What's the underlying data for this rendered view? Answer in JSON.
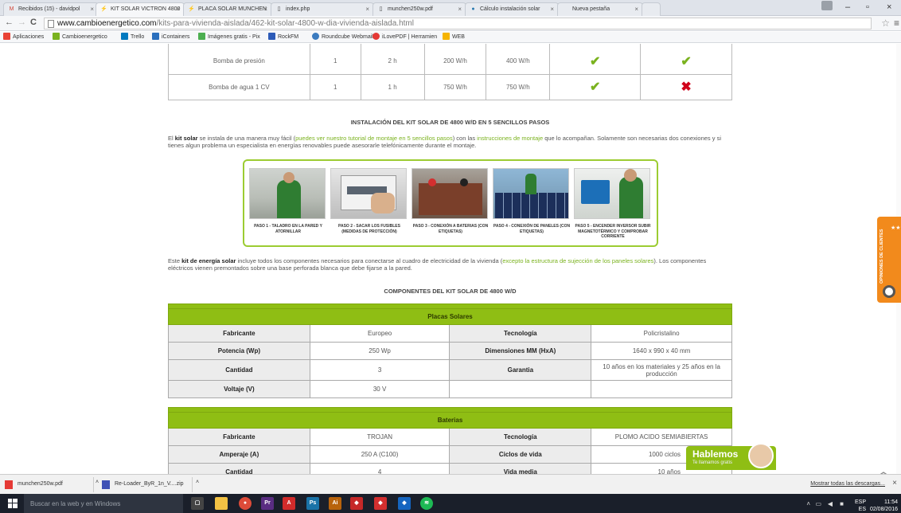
{
  "browser": {
    "tabs": [
      {
        "label": "Recibidos (15) - davidpol",
        "icon": "gmail-icon",
        "active": false
      },
      {
        "label": "KIT SOLAR VICTRON 4800",
        "icon": "site-icon",
        "active": true
      },
      {
        "label": "PLACA SOLAR MUNCHEN",
        "icon": "site-icon",
        "active": false
      },
      {
        "label": "index.php",
        "icon": "page-icon",
        "active": false
      },
      {
        "label": "munchen250w.pdf",
        "icon": "page-icon",
        "active": false
      },
      {
        "label": "Cálculo instalación solar",
        "icon": "globe-icon",
        "active": false
      },
      {
        "label": "Nueva pestaña",
        "icon": "blank-icon",
        "active": false
      }
    ],
    "url_domain": "www.cambioenergetico.com",
    "url_path": "/kits-para-vivienda-aislada/462-kit-solar-4800-w-dia-vivienda-aislada.html",
    "bookmarks": [
      {
        "label": "Aplicaciones",
        "color": "#e94235"
      },
      {
        "label": "Cambioenergetico",
        "color": "#7ab21e"
      },
      {
        "label": "Trello",
        "color": "#0079bf"
      },
      {
        "label": "iContainers",
        "color": "#2a6fbd"
      },
      {
        "label": "Imágenes gratis - Pix",
        "color": "#4caf50"
      },
      {
        "label": "RockFM",
        "color": "#2d5bb8"
      },
      {
        "label": "Roundcube Webmail",
        "color": "#3b7bbf"
      },
      {
        "label": "iLovePDF | Herramien",
        "color": "#e53935"
      },
      {
        "label": "WEB",
        "color": "#f5b400"
      }
    ]
  },
  "top_table": {
    "rows": [
      {
        "name": "Bomba de presión",
        "qty": "1",
        "hours": "2 h",
        "power": "200 W/h",
        "total": "400 W/h",
        "a": "check",
        "b": "check"
      },
      {
        "name": "Bomba de agua 1 CV",
        "qty": "1",
        "hours": "1 h",
        "power": "750 W/h",
        "total": "750 W/h",
        "a": "check",
        "b": "cross"
      }
    ]
  },
  "install": {
    "heading": "INSTALACIÓN DEL KIT SOLAR DE 4800 W/D EN 5 SENCILLOS PASOS",
    "p1_a": "El ",
    "p1_b": "kit solar",
    "p1_c": " se instala de una manera muy fácil (",
    "p1_link1": "puedes ver nuestro tutorial de montaje en 5 sencillos pasos",
    "p1_d": ") con las ",
    "p1_link2": "instrucciones de montaje",
    "p1_e": " que lo acompañan. Solamente son necesarias dos conexiones y si tienes algun problema un especialista en energías renovables puede asesorarle telefónicamente durante el montaje.",
    "steps": [
      "PASO 1 - TALADRO EN LA PARED Y ATORNILLAR",
      "PASO 2 - SACAR LOS FUSIBLES (MEDIDAS DE PROTECCIÓN)",
      "PASO 3 - CONEXIÓN A BATERIAS (CON ETIQUETAS)",
      "PASO 4 - CONEXIÓN DE PANELES (CON ETIQUETAS)",
      "PASO 5 - ENCENDER INVERSOR SUBIR MAGNETOTÉRMICO Y COMPROBAR CORRIENTE"
    ],
    "p2_a": "Este ",
    "p2_b": "kit de energía solar",
    "p2_c": " incluye todos los componentes necesarios para conectarse al cuadro de electricidad de la vivienda (",
    "p2_link": "excepto la estructura de sujección de los paneles solares",
    "p2_d": "). Los componentes eléctricos vienen premontados sobre una base perforada blanca que debe fijarse a la pared."
  },
  "components": {
    "heading": "COMPONENTES DEL KIT SOLAR DE 4800 W/D",
    "placas": {
      "title": "Placas Solares",
      "rows": [
        [
          "Fabricante",
          "Europeo",
          "Tecnología",
          "Policristalino"
        ],
        [
          "Potencia (Wp)",
          "250 Wp",
          "Dimensiones MM (HxA)",
          "1640 x 990 x 40 mm"
        ],
        [
          "Cantidad",
          "3",
          "Garantia",
          "10 años en los materiales y 25 años en la producción"
        ],
        [
          "Voltaje (V)",
          "30 V",
          "",
          ""
        ]
      ]
    },
    "baterias": {
      "title": "Baterias",
      "rows": [
        [
          "Fabricante",
          "TROJAN",
          "Tecnología",
          "PLOMO ACIDO SEMIABIERTAS"
        ],
        [
          "Amperaje (A)",
          "250 A (C100)",
          "Ciclos de vida",
          "1000 ciclos"
        ],
        [
          "Cantidad",
          "4",
          "Vida media",
          "10 años"
        ]
      ]
    }
  },
  "widgets": {
    "opinion_text": "OPINIONES DE CLIENTES",
    "stars": "★★★★★",
    "hablemos_title": "Hablemos",
    "hablemos_sub": "Te llamamos gratis"
  },
  "downloads": {
    "items": [
      "munchen250w.pdf",
      "Re-Loader_ByR_1n_V....zip"
    ],
    "show_all": "Mostrar todas las descargas..."
  },
  "taskbar": {
    "search_placeholder": "Buscar en la web y en Windows",
    "lang": "ESP",
    "lang2": "ES",
    "time": "11:54",
    "date": "02/08/2016",
    "apps": [
      {
        "name": "task-view-icon",
        "color": "#444",
        "glyph": "▢"
      },
      {
        "name": "file-explorer-icon",
        "color": "#f3c244",
        "glyph": ""
      },
      {
        "name": "chrome-icon",
        "color": "#dd4b39",
        "glyph": "●"
      },
      {
        "name": "premiere-icon",
        "color": "#5a2d82",
        "glyph": "Pr"
      },
      {
        "name": "acrobat-icon",
        "color": "#d12b2b",
        "glyph": "A"
      },
      {
        "name": "photoshop-icon",
        "color": "#1a73a8",
        "glyph": "Ps"
      },
      {
        "name": "illustrator-icon",
        "color": "#b8630c",
        "glyph": "Ai"
      },
      {
        "name": "app-red-icon",
        "color": "#c62828",
        "glyph": "◆"
      },
      {
        "name": "app-green-icon",
        "color": "#d32f2f",
        "glyph": "◆"
      },
      {
        "name": "app-blue-icon",
        "color": "#1565c0",
        "glyph": "◆"
      },
      {
        "name": "spotify-icon",
        "color": "#1db954",
        "glyph": "≋"
      }
    ]
  },
  "colors": {
    "accent_green": "#8fbe14",
    "check": "#7ab21e",
    "cross": "#d0021b",
    "orange": "#f28a1c"
  }
}
